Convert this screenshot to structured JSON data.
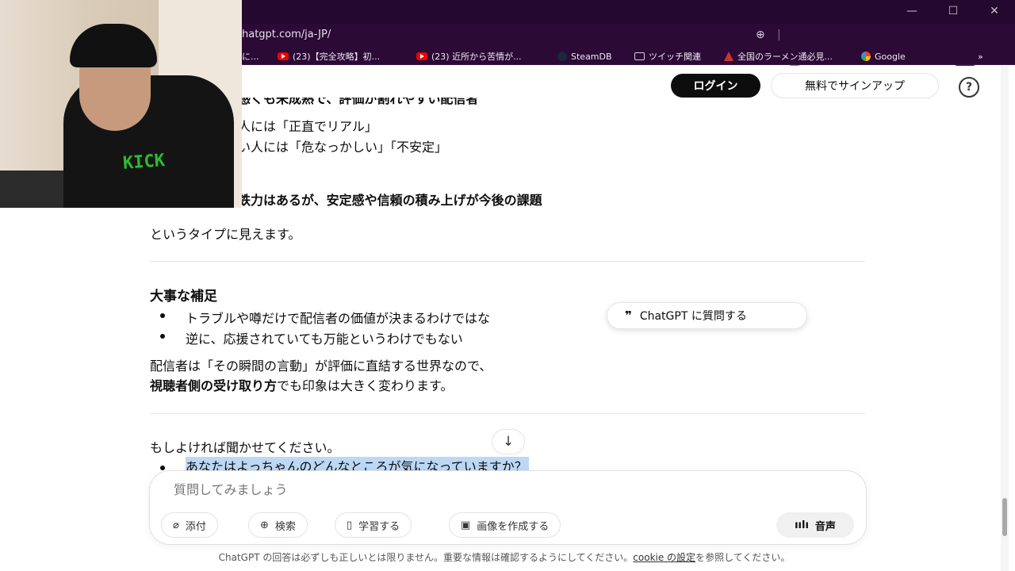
{
  "browser": {
    "url": "hatgpt.com/ja-JP/",
    "window_controls": [
      "—",
      "☐",
      "✕"
    ],
    "bookmarks": [
      {
        "label": "に...",
        "icon": "text"
      },
      {
        "label": "(23)【完全攻略】初...",
        "icon": "youtube-icon"
      },
      {
        "label": "(23) 近所から苦情が...",
        "icon": "youtube-icon"
      },
      {
        "label": "SteamDB",
        "icon": "steam-icon"
      },
      {
        "label": "ツイッチ関連",
        "icon": "folder-icon"
      },
      {
        "label": "全国のラーメン通必見...",
        "icon": "ramen-icon"
      },
      {
        "label": "Google",
        "icon": "google-icon"
      }
    ],
    "overflow": "»"
  },
  "header": {
    "login_label": "ログイン",
    "signup_label": "無料でサインアップ",
    "help_label": "?"
  },
  "content": {
    "line_cut": "感くも未成熟で、評価が割れやすい配信者",
    "line1": "人には「正直でリアル」",
    "line2": "い人には「危なっかしい」「不安定」",
    "summary_bold": "鉄力はあるが、安定感や信頼の積み上げが今後の課題",
    "summary_tail": "というタイプに見えます。",
    "section_title": "大事な補足",
    "bullets": [
      "トラブルや噂だけで配信者の価値が決まるわけではな",
      "逆に、応援されていても万能というわけでもない"
    ],
    "para1": "配信者は「その瞬間の言動」が評価に直結する世界なので、",
    "para2_bold": "視聴者側の受け取り方",
    "para2_tail": "でも印象は大きく変わります。",
    "ask_prompt": "もしよければ聞かせてください。",
    "highlighted_question": "あなたはよっちゃんのどんなところが気になっていますか？"
  },
  "ask_chip": {
    "icon": "quote-icon",
    "label": "ChatGPT に質問する"
  },
  "composer": {
    "placeholder": "質問してみましょう",
    "tools": [
      {
        "label": "添付",
        "icon": "paperclip-icon"
      },
      {
        "label": "検索",
        "icon": "globe-icon"
      },
      {
        "label": "学習する",
        "icon": "book-icon"
      },
      {
        "label": "画像を作成する",
        "icon": "image-icon"
      }
    ],
    "voice_label": "音声"
  },
  "footer": {
    "disclaimer_pre": "ChatGPT の回答は必ずしも正しいとは限りません。重要な情報は確認するようにしてください。",
    "cookie_link": "cookie の設定",
    "disclaimer_post": "を参照してください。"
  },
  "webcam": {
    "shirt_text": "KICK"
  }
}
